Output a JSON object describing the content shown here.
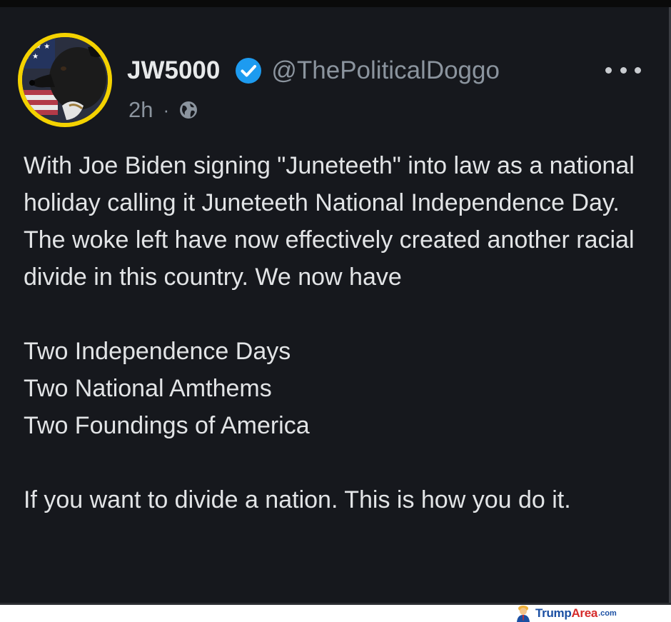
{
  "post": {
    "author": {
      "display_name": "JW5000",
      "handle": "@ThePoliticalDoggo",
      "verified": true,
      "avatar_ring_color": "#f4d200",
      "verified_color": "#1d9bf0"
    },
    "timestamp": "2h",
    "separator": "·",
    "visibility_icon": "globe-icon",
    "more_icon": "more-options-icon",
    "body": {
      "paragraph_1": "With Joe Biden signing \"Juneteeth\" into law as a national holiday calling it Juneteeth National Independence Day. The woke left have now effectively created another racial divide in this country. We now have",
      "line_1": "Two Independence Days",
      "line_2": "Two National Amthems",
      "line_3": "Two Foundings of America",
      "paragraph_2": "If you want to divide a nation. This is how you do it."
    }
  },
  "watermark": {
    "part_1": "Trump",
    "part_2": "Area",
    "part_3": ".com"
  },
  "colors": {
    "background": "#16181d",
    "text": "#e2e4e6",
    "muted": "#8b949e"
  }
}
